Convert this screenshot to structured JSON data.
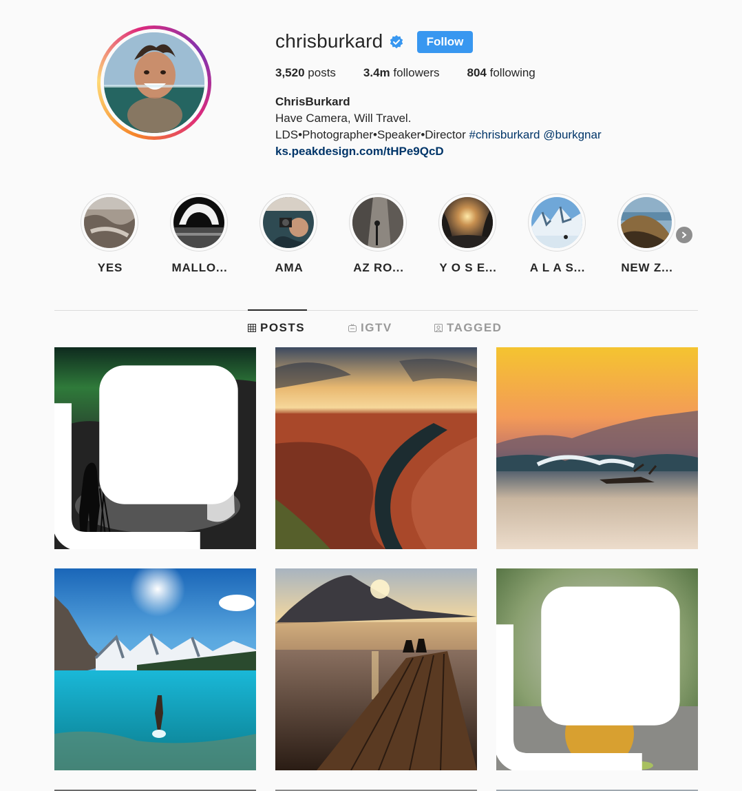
{
  "profile": {
    "username": "chrisburkard",
    "follow_label": "Follow",
    "stats": {
      "posts_count": "3,520",
      "posts_label": "posts",
      "followers_count": "3.4m",
      "followers_label": "followers",
      "following_count": "804",
      "following_label": "following"
    },
    "full_name": "ChrisBurkard",
    "bio_line1": "Have Camera, Will Travel.",
    "bio_line2": "LDS•Photographer•Speaker•Director",
    "hashtag": "#chrisburkard",
    "mention": "@burkgnar",
    "link": "ks.peakdesign.com/tHPe9QcD"
  },
  "highlights": [
    {
      "label": "YES"
    },
    {
      "label": "MALLO..."
    },
    {
      "label": "AMA"
    },
    {
      "label": "AZ RO..."
    },
    {
      "label": "Y O S E..."
    },
    {
      "label": "A L A S..."
    },
    {
      "label": "NEW Z..."
    }
  ],
  "tabs": {
    "posts": "POSTS",
    "igtv": "IGTV",
    "tagged": "TAGGED"
  },
  "colors": {
    "follow_button": "#3897f0",
    "link": "#003569",
    "verified": "#3897f0"
  },
  "icons": {
    "verified": "verified-badge-icon",
    "next": "chevron-right-icon",
    "posts_tab": "grid-icon",
    "igtv_tab": "tv-icon",
    "tagged_tab": "tag-person-icon",
    "multi_post": "carousel-icon"
  }
}
